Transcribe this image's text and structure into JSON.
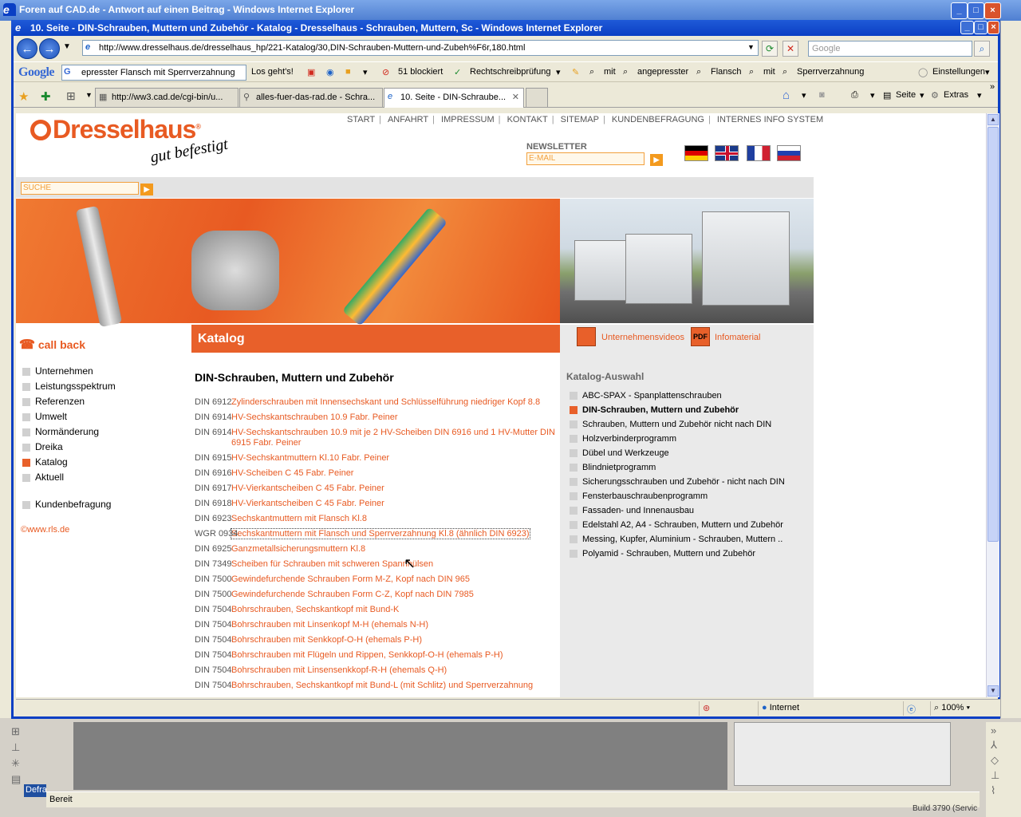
{
  "bg_window": {
    "title": "Foren auf CAD.de - Antwort auf einen Beitrag - Windows Internet Explorer",
    "status": "Bereit",
    "taskbar_tab": "Defra",
    "build": "Build 3790 (Servic"
  },
  "ie": {
    "title": "10. Seite - DIN-Schrauben, Muttern und Zubehör - Katalog - Dresselhaus - Schrauben, Muttern, Sc - Windows Internet Explorer",
    "address": "http://www.dresselhaus.de/dresselhaus_hp/221-Katalog/30,DIN-Schrauben-Muttern-und-Zubeh%F6r,180.html",
    "search_placeholder": "Google",
    "google_logo": "Google",
    "google_query": "epresster Flansch mit Sperrverzahnung",
    "losgehts": "Los geht's!",
    "blocked": "51 blockiert",
    "spell": "Rechtschreibprüfung",
    "terms": [
      "mit",
      "angepresster",
      "Flansch",
      "mit",
      "Sperrverzahnung"
    ],
    "settings": "Einstellungen",
    "tabs": [
      "http://ww3.cad.de/cgi-bin/u...",
      "alles-fuer-das-rad.de - Schra...",
      "10. Seite - DIN-Schraube..."
    ],
    "seite": "Seite",
    "extras": "Extras",
    "status_zone": "Internet",
    "zoom": "100%"
  },
  "page": {
    "logo": "Dresselhaus",
    "slogan": "gut befestigt",
    "topnav": [
      "START",
      "ANFAHRT",
      "IMPRESSUM",
      "KONTAKT",
      "SITEMAP",
      "KUNDENBEFRAGUNG",
      "INTERNES INFO SYSTEM"
    ],
    "newsletter": "NEWSLETTER",
    "email_placeholder": "E-MAIL",
    "search_placeholder": "SUCHE",
    "callback": "call back",
    "katalog_header": "Katalog",
    "videos": "Unternehmensvideos",
    "pdf_label": "PDF",
    "infomaterial": "Infomaterial",
    "side_menu": [
      "Unternehmen",
      "Leistungsspektrum",
      "Referenzen",
      "Umwelt",
      "Normänderung",
      "Dreika",
      "Katalog",
      "Aktuell"
    ],
    "kundenbefragung": "Kundenbefragung",
    "rls": "©www.rls.de",
    "main_title": "DIN-Schrauben, Muttern und Zubehör",
    "items": [
      {
        "code": "DIN 6912",
        "text": "Zylinderschrauben mit Innensechskant und Schlüsselführung niedriger Kopf 8.8"
      },
      {
        "code": "DIN 6914",
        "text": "HV-Sechskantschrauben 10.9 Fabr. Peiner"
      },
      {
        "code": "DIN 6914",
        "text": "HV-Sechskantschrauben 10.9 mit je 2 HV-Scheiben DIN 6916 und 1 HV-Mutter DIN 6915 Fabr. Peiner"
      },
      {
        "code": "DIN 6915",
        "text": "HV-Sechskantmuttern Kl.10 Fabr. Peiner"
      },
      {
        "code": "DIN 6916",
        "text": "HV-Scheiben C 45 Fabr. Peiner"
      },
      {
        "code": "DIN 6917",
        "text": "HV-Vierkantscheiben C 45 Fabr. Peiner"
      },
      {
        "code": "DIN 6918",
        "text": "HV-Vierkantscheiben C 45 Fabr. Peiner"
      },
      {
        "code": "DIN 6923",
        "text": "Sechskantmuttern mit Flansch Kl.8"
      },
      {
        "code": "WGR 0934",
        "text": "Sechskantmuttern mit Flansch und Sperrverzahnung Kl.8 (ähnlich DIN 6923)"
      },
      {
        "code": "DIN 6925",
        "text": "Ganzmetallsicherungsmuttern Kl.8"
      },
      {
        "code": "DIN 7349",
        "text": "Scheiben für Schrauben mit schweren Spannhülsen"
      },
      {
        "code": "DIN 7500",
        "text": "Gewindefurchende Schrauben Form M-Z, Kopf nach DIN 965"
      },
      {
        "code": "DIN 7500",
        "text": "Gewindefurchende Schrauben Form C-Z, Kopf nach DIN 7985"
      },
      {
        "code": "DIN 7504",
        "text": "Bohrschrauben, Sechskantkopf mit Bund-K"
      },
      {
        "code": "DIN 7504",
        "text": "Bohrschrauben mit Linsenkopf M-H (ehemals N-H)"
      },
      {
        "code": "DIN 7504",
        "text": "Bohrschrauben mit Senkkopf-O-H (ehemals P-H)"
      },
      {
        "code": "DIN 7504",
        "text": "Bohrschrauben mit Flügeln und Rippen, Senkkopf-O-H (ehemals P-H)"
      },
      {
        "code": "DIN 7504",
        "text": "Bohrschrauben mit Linsensenkkopf-R-H (ehemals Q-H)"
      },
      {
        "code": "DIN 7504",
        "text": "Bohrschrauben, Sechskantkopf mit Bund-L (mit Schlitz) und Sperrverzahnung"
      }
    ],
    "katalog_auswahl": "Katalog-Auswahl",
    "catalog": [
      "ABC-SPAX - Spanplattenschrauben",
      "DIN-Schrauben, Muttern und Zubehör",
      "Schrauben, Muttern und Zubehör nicht nach DIN",
      "Holzverbinderprogramm",
      "Dübel und Werkzeuge",
      "Blindnietprogramm",
      "Sicherungsschrauben und Zubehör - nicht nach DIN",
      "Fensterbauschraubenprogramm",
      "Fassaden- und Innenausbau",
      "Edelstahl A2, A4 - Schrauben, Muttern und Zubehör",
      "Messing, Kupfer, Aluminium - Schrauben, Muttern ..",
      "Polyamid - Schrauben, Muttern und Zubehör"
    ]
  },
  "colors": {
    "brand": "#e85a22",
    "title_blue": "#0a3fc4"
  }
}
